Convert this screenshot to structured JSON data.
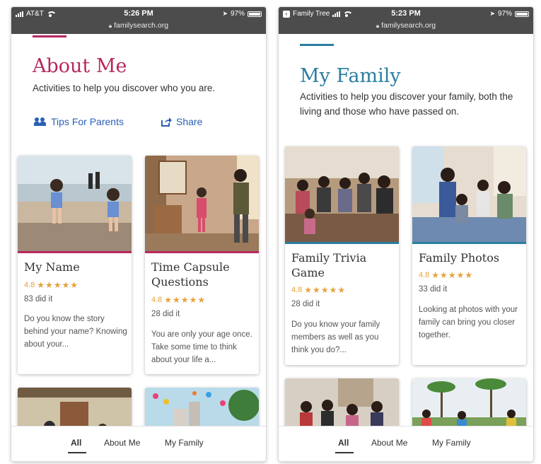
{
  "left": {
    "status": {
      "carrier": "AT&T",
      "time": "5:26 PM",
      "battery": "97%",
      "url": "familysearch.org"
    },
    "page": {
      "title": "About Me",
      "description": "Activities to help you discover who you are.",
      "accent_color": "#b8285e"
    },
    "actions": {
      "tips_label": "Tips For Parents",
      "share_label": "Share"
    },
    "cards": [
      {
        "title": "My Name",
        "rating": "4.8",
        "stars": "★★★★★",
        "did": "83 did it",
        "desc": "Do you know the story behind your name? Knowing about your..."
      },
      {
        "title": "Time Capsule Questions",
        "rating": "4.8",
        "stars": "★★★★★",
        "did": "28 did it",
        "desc": "You are only your age once. Take some time to think about your life a..."
      }
    ],
    "nav": {
      "all": "All",
      "about": "About Me",
      "family": "My Family"
    }
  },
  "right": {
    "status": {
      "back_app": "Family Tree",
      "time": "5:23 PM",
      "battery": "97%",
      "url": "familysearch.org"
    },
    "page": {
      "title": "My Family",
      "description": "Activities to help you discover your family, both the living and those who have passed on.",
      "accent_color": "#2a7e9f"
    },
    "cards": [
      {
        "title": "Family Trivia Game",
        "rating": "4.8",
        "stars": "★★★★★",
        "did": "28 did it",
        "desc": "Do you know your family members as well as you think you do?..."
      },
      {
        "title": "Family Photos",
        "rating": "4.8",
        "stars": "★★★★★",
        "did": "33 did it",
        "desc": "Looking at photos with your family can bring you closer together."
      }
    ],
    "nav": {
      "all": "All",
      "about": "About Me",
      "family": "My Family"
    }
  }
}
